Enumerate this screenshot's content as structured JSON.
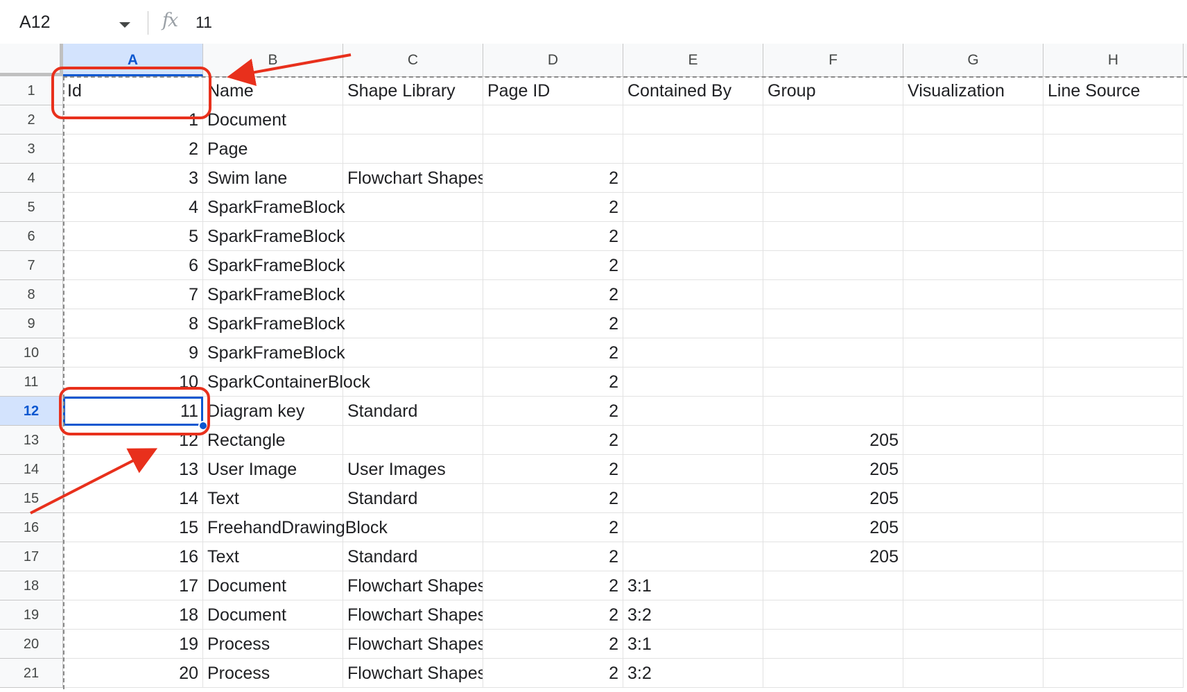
{
  "formula_bar": {
    "name_box": "A12",
    "fx_symbol": "fx",
    "value": "11"
  },
  "columns": [
    "A",
    "B",
    "C",
    "D",
    "E",
    "F",
    "G",
    "H"
  ],
  "selected_column": "A",
  "selected_row": "12",
  "rows": [
    {
      "num": "1",
      "cells": [
        "Id",
        "Name",
        "Shape Library",
        "Page ID",
        "Contained By",
        "Group",
        "Visualization",
        "Line Source"
      ]
    },
    {
      "num": "2",
      "cells": [
        "1",
        "Document",
        "",
        "",
        "",
        "",
        "",
        ""
      ]
    },
    {
      "num": "3",
      "cells": [
        "2",
        "Page",
        "",
        "",
        "",
        "",
        "",
        ""
      ]
    },
    {
      "num": "4",
      "cells": [
        "3",
        "Swim lane",
        "Flowchart Shapes",
        "2",
        "",
        "",
        "",
        ""
      ]
    },
    {
      "num": "5",
      "cells": [
        "4",
        "SparkFrameBlock",
        "",
        "2",
        "",
        "",
        "",
        ""
      ]
    },
    {
      "num": "6",
      "cells": [
        "5",
        "SparkFrameBlock",
        "",
        "2",
        "",
        "",
        "",
        ""
      ]
    },
    {
      "num": "7",
      "cells": [
        "6",
        "SparkFrameBlock",
        "",
        "2",
        "",
        "",
        "",
        ""
      ]
    },
    {
      "num": "8",
      "cells": [
        "7",
        "SparkFrameBlock",
        "",
        "2",
        "",
        "",
        "",
        ""
      ]
    },
    {
      "num": "9",
      "cells": [
        "8",
        "SparkFrameBlock",
        "",
        "2",
        "",
        "",
        "",
        ""
      ]
    },
    {
      "num": "10",
      "cells": [
        "9",
        "SparkFrameBlock",
        "",
        "2",
        "",
        "",
        "",
        ""
      ]
    },
    {
      "num": "11",
      "cells": [
        "10",
        "SparkContainerBlock",
        "",
        "2",
        "",
        "",
        "",
        ""
      ]
    },
    {
      "num": "12",
      "cells": [
        "11",
        "Diagram key",
        "Standard",
        "2",
        "",
        "",
        "",
        ""
      ]
    },
    {
      "num": "13",
      "cells": [
        "12",
        "Rectangle",
        "",
        "2",
        "",
        "205",
        "",
        ""
      ]
    },
    {
      "num": "14",
      "cells": [
        "13",
        "User Image",
        "User Images",
        "2",
        "",
        "205",
        "",
        ""
      ]
    },
    {
      "num": "15",
      "cells": [
        "14",
        "Text",
        "Standard",
        "2",
        "",
        "205",
        "",
        ""
      ]
    },
    {
      "num": "16",
      "cells": [
        "15",
        "FreehandDrawingBlock",
        "",
        "2",
        "",
        "205",
        "",
        ""
      ]
    },
    {
      "num": "17",
      "cells": [
        "16",
        "Text",
        "Standard",
        "2",
        "",
        "205",
        "",
        ""
      ]
    },
    {
      "num": "18",
      "cells": [
        "17",
        "Document",
        "Flowchart Shapes",
        "2",
        "3:1",
        "",
        "",
        ""
      ]
    },
    {
      "num": "19",
      "cells": [
        "18",
        "Document",
        "Flowchart Shapes",
        "2",
        "3:2",
        "",
        "",
        ""
      ]
    },
    {
      "num": "20",
      "cells": [
        "19",
        "Process",
        "Flowchart Shapes",
        "2",
        "3:1",
        "",
        "",
        ""
      ]
    },
    {
      "num": "21",
      "cells": [
        "20",
        "Process",
        "Flowchart Shapes",
        "2",
        "3:2",
        "",
        "",
        ""
      ]
    }
  ],
  "annotation_color": "#e8301c",
  "selection_color": "#0b57d0"
}
